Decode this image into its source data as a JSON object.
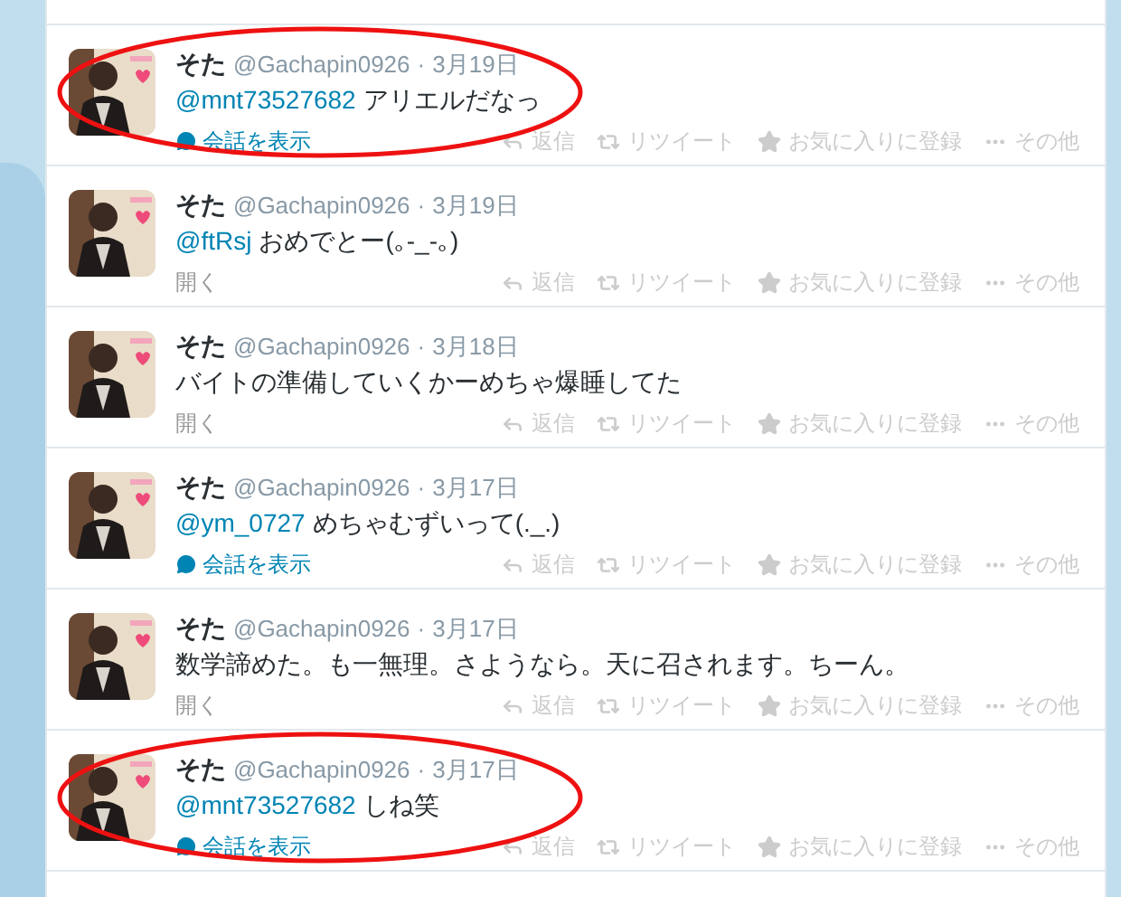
{
  "tweets": [
    {
      "name": "そた",
      "handle": "@Gachapin0926",
      "separator": "·",
      "date": "3月19日",
      "mention": "@mnt73527682",
      "text": "アリエルだなっ",
      "footer": {
        "kind": "conversation",
        "label": "会話を表示"
      },
      "circled": true,
      "actions": [
        {
          "kind": "reply",
          "label": "返信"
        },
        {
          "kind": "retweet",
          "label": "リツイート"
        },
        {
          "kind": "favorite",
          "label": "お気に入りに登録"
        },
        {
          "kind": "more",
          "label": "その他"
        }
      ]
    },
    {
      "name": "そた",
      "handle": "@Gachapin0926",
      "separator": "·",
      "date": "3月19日",
      "mention": "@ftRsj",
      "text": "おめでとー(｡-_-｡)",
      "footer": {
        "kind": "open",
        "label": "開く"
      },
      "circled": false,
      "actions": [
        {
          "kind": "reply",
          "label": "返信"
        },
        {
          "kind": "retweet",
          "label": "リツイート"
        },
        {
          "kind": "favorite",
          "label": "お気に入りに登録"
        },
        {
          "kind": "more",
          "label": "その他"
        }
      ]
    },
    {
      "name": "そた",
      "handle": "@Gachapin0926",
      "separator": "·",
      "date": "3月18日",
      "text": "バイトの準備していくかーめちゃ爆睡してた",
      "footer": {
        "kind": "open",
        "label": "開く"
      },
      "circled": false,
      "actions": [
        {
          "kind": "reply",
          "label": "返信"
        },
        {
          "kind": "retweet",
          "label": "リツイート"
        },
        {
          "kind": "favorite",
          "label": "お気に入りに登録"
        },
        {
          "kind": "more",
          "label": "その他"
        }
      ]
    },
    {
      "name": "そた",
      "handle": "@Gachapin0926",
      "separator": "·",
      "date": "3月17日",
      "mention": "@ym_0727",
      "text": "めちゃむずいって(._.)",
      "footer": {
        "kind": "conversation",
        "label": "会話を表示"
      },
      "circled": false,
      "actions": [
        {
          "kind": "reply",
          "label": "返信"
        },
        {
          "kind": "retweet",
          "label": "リツイート"
        },
        {
          "kind": "favorite",
          "label": "お気に入りに登録"
        },
        {
          "kind": "more",
          "label": "その他"
        }
      ]
    },
    {
      "name": "そた",
      "handle": "@Gachapin0926",
      "separator": "·",
      "date": "3月17日",
      "text": "数学諦めた。も一無理。さようなら。天に召されます。ちーん。",
      "footer": {
        "kind": "open",
        "label": "開く"
      },
      "circled": false,
      "actions": [
        {
          "kind": "reply",
          "label": "返信"
        },
        {
          "kind": "retweet",
          "label": "リツイート"
        },
        {
          "kind": "favorite",
          "label": "お気に入りに登録"
        },
        {
          "kind": "more",
          "label": "その他"
        }
      ]
    },
    {
      "name": "そた",
      "handle": "@Gachapin0926",
      "separator": "·",
      "date": "3月17日",
      "mention": "@mnt73527682",
      "text": "しね笑",
      "footer": {
        "kind": "conversation",
        "label": "会話を表示"
      },
      "circled": true,
      "actions": [
        {
          "kind": "reply",
          "label": "返信"
        },
        {
          "kind": "retweet",
          "label": "リツイート"
        },
        {
          "kind": "favorite",
          "label": "お気に入りに登録"
        },
        {
          "kind": "more",
          "label": "その他"
        }
      ]
    }
  ]
}
